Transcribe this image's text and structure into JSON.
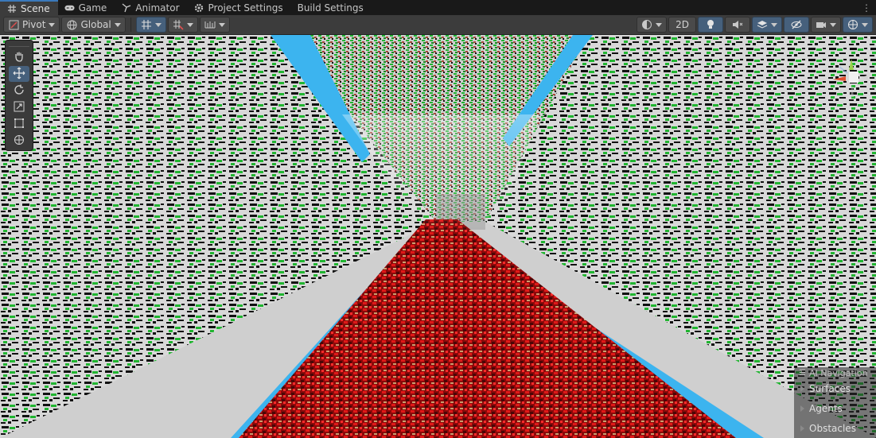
{
  "tabs": [
    {
      "label": "Scene",
      "icon": "grid-icon",
      "active": true
    },
    {
      "label": "Game",
      "icon": "gamepad-icon",
      "active": false
    },
    {
      "label": "Animator",
      "icon": "animator-icon",
      "active": false
    },
    {
      "label": "Project Settings",
      "icon": "gear-icon",
      "active": false
    },
    {
      "label": "Build Settings",
      "icon": "",
      "active": false
    }
  ],
  "toolbar": {
    "pivot_label": "Pivot",
    "global_label": "Global",
    "twod_label": "2D"
  },
  "tools_palette": [
    "hand-icon",
    "move-icon",
    "rotate-icon",
    "scale-icon",
    "rect-tool-icon",
    "transform-icon"
  ],
  "ai_navigation": {
    "title": "AI Navigation",
    "items": [
      "Surfaces",
      "Agents",
      "Obstacles"
    ]
  },
  "colors": {
    "wall_base": "#d8d8d8",
    "wall_green": "#21b531",
    "floor_red": "#b01010",
    "edge_blue": "#3cb4ef",
    "accent": "#3a79bb"
  }
}
